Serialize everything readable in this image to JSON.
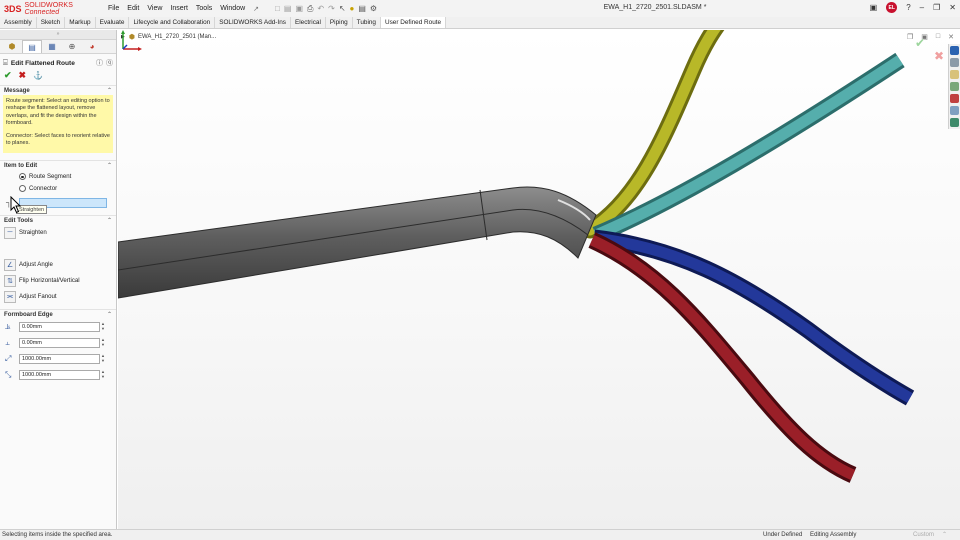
{
  "app": {
    "brand_prefix": "3DS",
    "brand_name": "SOLIDWORKS",
    "brand_suffix": "Connected",
    "document_title": "EWA_H1_2720_2501.SLDASM *",
    "user_initials": "EL"
  },
  "menu": [
    "File",
    "Edit",
    "View",
    "Insert",
    "Tools",
    "Window"
  ],
  "command_tabs": [
    {
      "label": "Assembly",
      "active": false
    },
    {
      "label": "Sketch",
      "active": false
    },
    {
      "label": "Markup",
      "active": false
    },
    {
      "label": "Evaluate",
      "active": false
    },
    {
      "label": "Lifecycle and Collaboration",
      "active": false
    },
    {
      "label": "SOLIDWORKS Add-Ins",
      "active": false
    },
    {
      "label": "Electrical",
      "active": false
    },
    {
      "label": "Piping",
      "active": false
    },
    {
      "label": "Tubing",
      "active": false
    },
    {
      "label": "User Defined Route",
      "active": true
    }
  ],
  "property_manager": {
    "title": "Edit Flattened Route",
    "message_heading": "Message",
    "message_paragraphs": [
      "Route segment: Select an editing option to reshape the flattened layout, remove overlaps, and fit the design within the formboard.",
      "Connector: Select faces to reorient relative to planes."
    ],
    "item_to_edit_heading": "Item to Edit",
    "item_options": [
      {
        "label": "Route Segment",
        "selected": true
      },
      {
        "label": "Connector",
        "selected": false
      }
    ],
    "edit_tools_heading": "Edit Tools",
    "edit_tools": [
      "Straighten",
      "Adjust Angle",
      "Flip Horizontal/Vertical",
      "Adjust Fanout"
    ],
    "tooltip": "Straighten",
    "formboard_heading": "Formboard Edge",
    "formboard_fields": [
      "0.00mm",
      "0.00mm",
      "1000.00mm",
      "1000.00mm"
    ]
  },
  "viewport": {
    "tree_item": "EWA_H1_2720_2501 (Man..."
  },
  "status": {
    "message": "Selecting items inside the specified area.",
    "definition": "Under Defined",
    "mode": "Editing Assembly",
    "units": "Custom"
  },
  "colors": {
    "trunk": "#5e5e5e",
    "yellow_wire": "#a8a81e",
    "teal_wire": "#4aa6a4",
    "blue_wire": "#1c2f86",
    "red_wire": "#8a1a22",
    "selection": "#cce6fb",
    "message_bg": "#fff9a8"
  }
}
